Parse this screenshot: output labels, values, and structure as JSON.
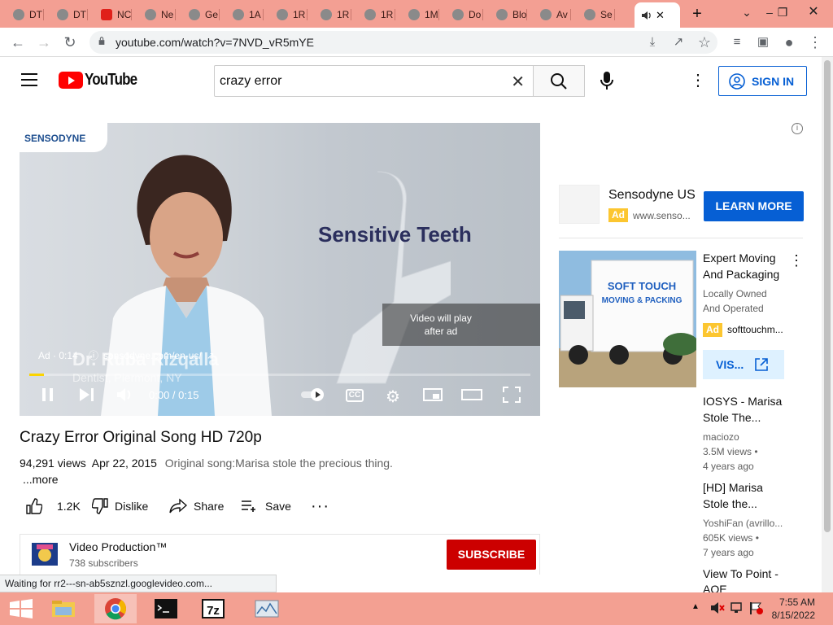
{
  "browser": {
    "tabs": [
      {
        "label": "DT"
      },
      {
        "label": "DT"
      },
      {
        "label": "NC"
      },
      {
        "label": "Ne"
      },
      {
        "label": "Ge"
      },
      {
        "label": "1A"
      },
      {
        "label": "1R"
      },
      {
        "label": "1R"
      },
      {
        "label": "1R"
      },
      {
        "label": "1M"
      },
      {
        "label": "Do"
      },
      {
        "label": "Blo"
      },
      {
        "label": "Av"
      },
      {
        "label": "Se"
      }
    ],
    "active_tab_close": "✕",
    "new_tab": "+",
    "url": "youtube.com/watch?v=7NVD_vR5mYE"
  },
  "youtube": {
    "logo_text": "YouTube",
    "search_value": "crazy error",
    "signin_label": "SIGN IN"
  },
  "player": {
    "brand": "SENSODYNE",
    "headline": "Sensitive Teeth",
    "presenter_name": "Dr. Ruba Rizqalla",
    "presenter_title": "Dentist, Piermont, NY",
    "skip_text_1": "Video will play",
    "skip_text_2": "after ad",
    "ad_label": "Ad · 0:14 ·",
    "ad_url": "sensodyne.com/en-us/",
    "time": "0:00 / 0:15",
    "progress_fraction": 0.03,
    "cc_label": "CC"
  },
  "video": {
    "title": "Crazy Error Original Song HD 720p",
    "views": "94,291 views",
    "date": "Apr 22, 2015",
    "description": "Original song:Marisa stole the precious thing.",
    "more": "...more",
    "likes": "1.2K",
    "dislike": "Dislike",
    "share": "Share",
    "save": "Save"
  },
  "channel": {
    "name": "Video Production™",
    "subscribers": "738 subscribers",
    "subscribe_label": "SUBSCRIBE"
  },
  "status_text": "Waiting for rr2---sn-ab5sznzl.googlevideo.com...",
  "sidebar": {
    "promo": {
      "name": "Sensodyne US",
      "badge": "Ad",
      "url": "www.senso...",
      "cta": "LEARN MORE"
    },
    "moving": {
      "title_1": "Expert Moving",
      "title_2": "And Packaging",
      "line_1": "Locally Owned",
      "line_2": "And Operated",
      "badge": "Ad",
      "domain": "softtouchm...",
      "visit": "VIS..."
    },
    "recs": [
      {
        "title_1": "IOSYS - Marisa",
        "title_2": "Stole The...",
        "channel": "maciozo",
        "views": "3.5M views •",
        "age": "4 years ago"
      },
      {
        "title_1": "[HD] Marisa",
        "title_2": "Stole the...",
        "channel": "YoshiFan (avrillo...",
        "views": "605K views •",
        "age": "7 years ago"
      },
      {
        "title_1": "View To Point -",
        "title_2": "AOE"
      }
    ]
  },
  "taskbar": {
    "time": "7:55 AM",
    "date": "8/15/2022"
  },
  "colors": {
    "tab_strip": "#f39f93",
    "yt_red": "#ff0000",
    "link_blue": "#065fd4",
    "subscribe_red": "#cc0000",
    "ad_yellow": "#fcc630"
  }
}
